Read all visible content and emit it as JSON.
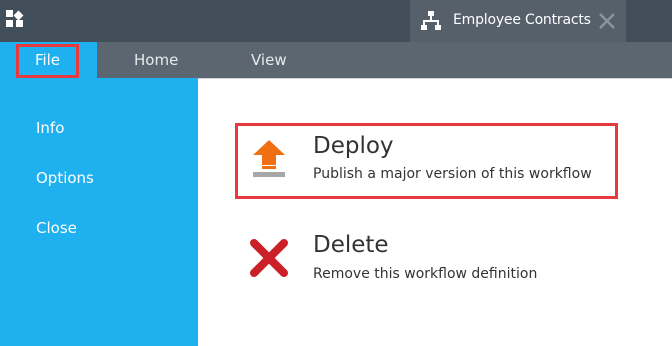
{
  "titlebar": {
    "app_icon": "app-grid-icon",
    "document_tab": {
      "icon": "workflow-hierarchy-icon",
      "label": "Employee Contracts",
      "close_icon": "close-icon"
    }
  },
  "ribbon": {
    "tabs": [
      {
        "label": "File",
        "selected": true
      },
      {
        "label": "Home",
        "selected": false
      },
      {
        "label": "View",
        "selected": false
      }
    ]
  },
  "backstage": {
    "menu": [
      {
        "label": "Info"
      },
      {
        "label": "Options"
      },
      {
        "label": "Close"
      }
    ],
    "actions": [
      {
        "title": "Deploy",
        "description": "Publish a major version of this workflow",
        "icon": "deploy-arrow-icon"
      },
      {
        "title": "Delete",
        "description": "Remove this workflow definition",
        "icon": "delete-x-icon"
      }
    ]
  },
  "colors": {
    "titlebar": "#424e5a",
    "ribbon": "#5c6670",
    "accent": "#1fb0ef",
    "highlight": "#e63a3f",
    "deploy_icon": "#ef6f12",
    "delete_icon": "#cc2028"
  }
}
